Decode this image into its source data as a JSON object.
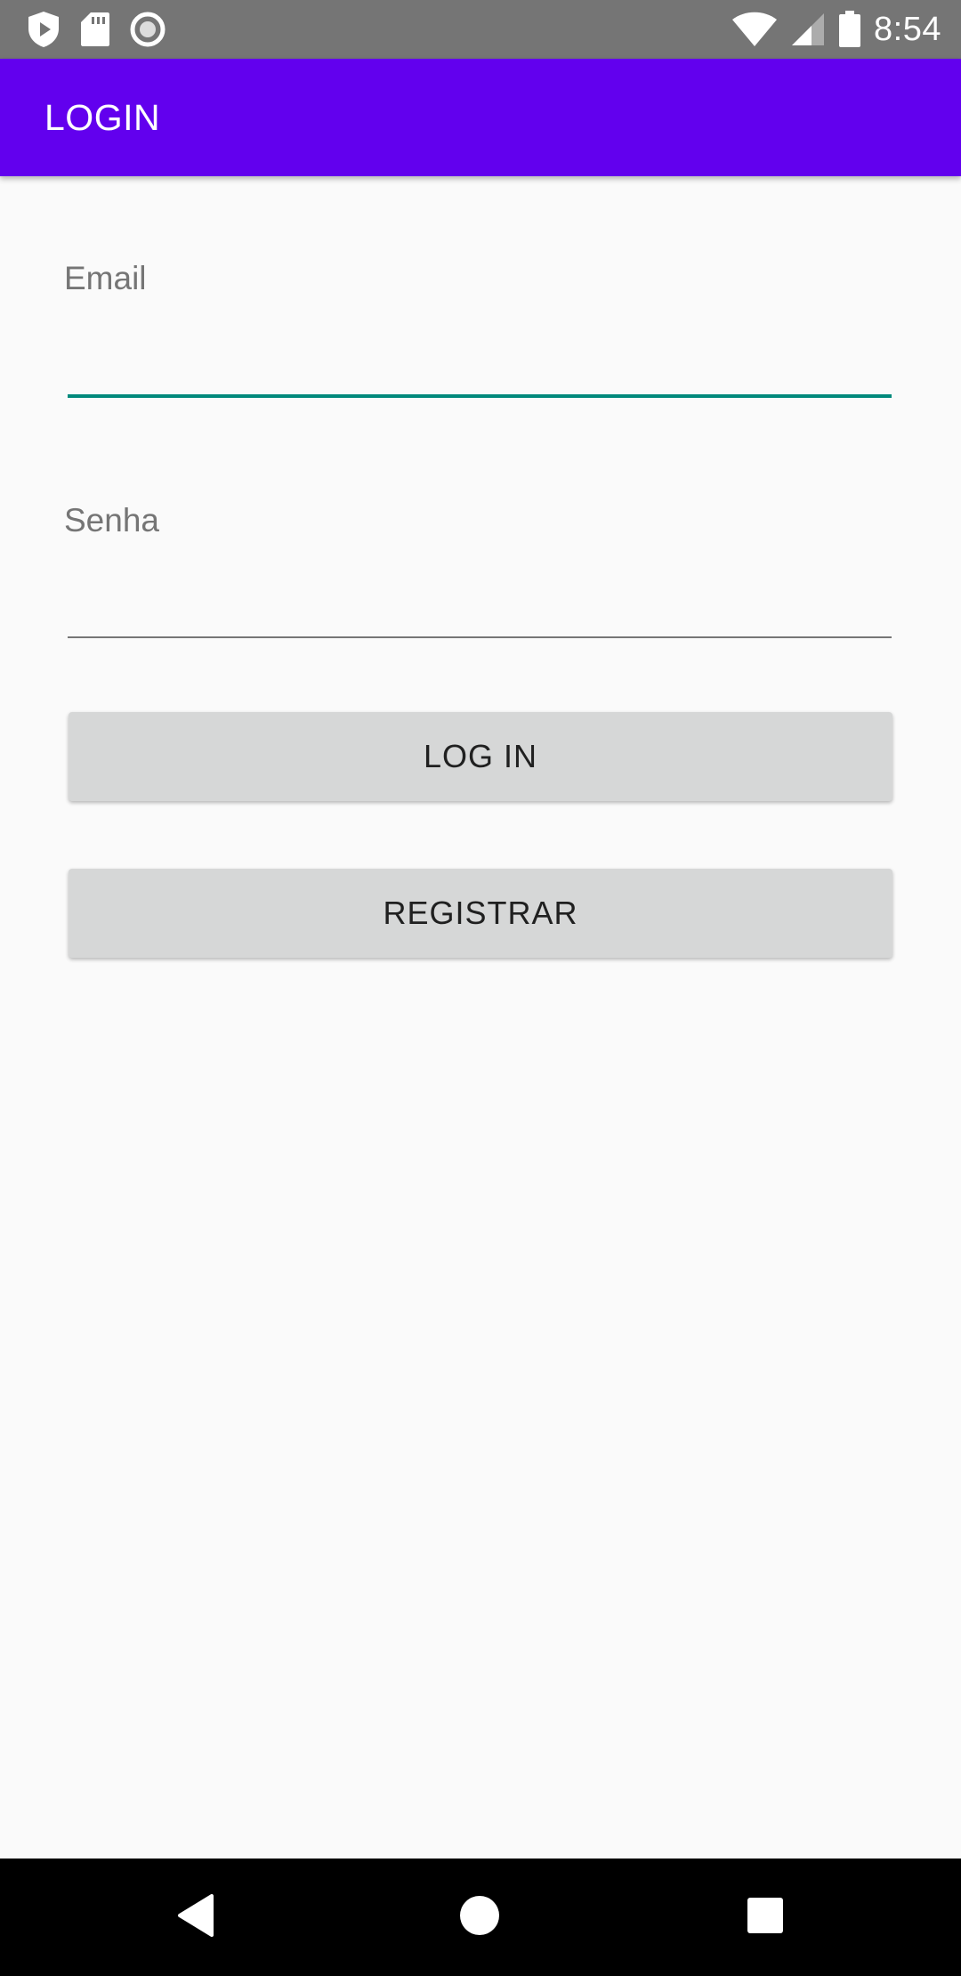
{
  "status_bar": {
    "time": "8:54",
    "left_icons": [
      "shield-play-icon",
      "sd-card-icon",
      "circle-record-icon"
    ],
    "right_icons": [
      "wifi-icon",
      "signal-icon",
      "battery-icon"
    ]
  },
  "app_bar": {
    "title": "LOGIN",
    "color": "#6200ee"
  },
  "form": {
    "email": {
      "label": "Email",
      "value": ""
    },
    "password": {
      "label": "Senha",
      "value": ""
    },
    "login_button": "LOG IN",
    "register_button": "REGISTRAR"
  },
  "nav_bar": {
    "icons": [
      "back-icon",
      "home-icon",
      "recents-icon"
    ]
  },
  "colors": {
    "accent": "#00897b",
    "button_bg": "#d6d7d7"
  }
}
